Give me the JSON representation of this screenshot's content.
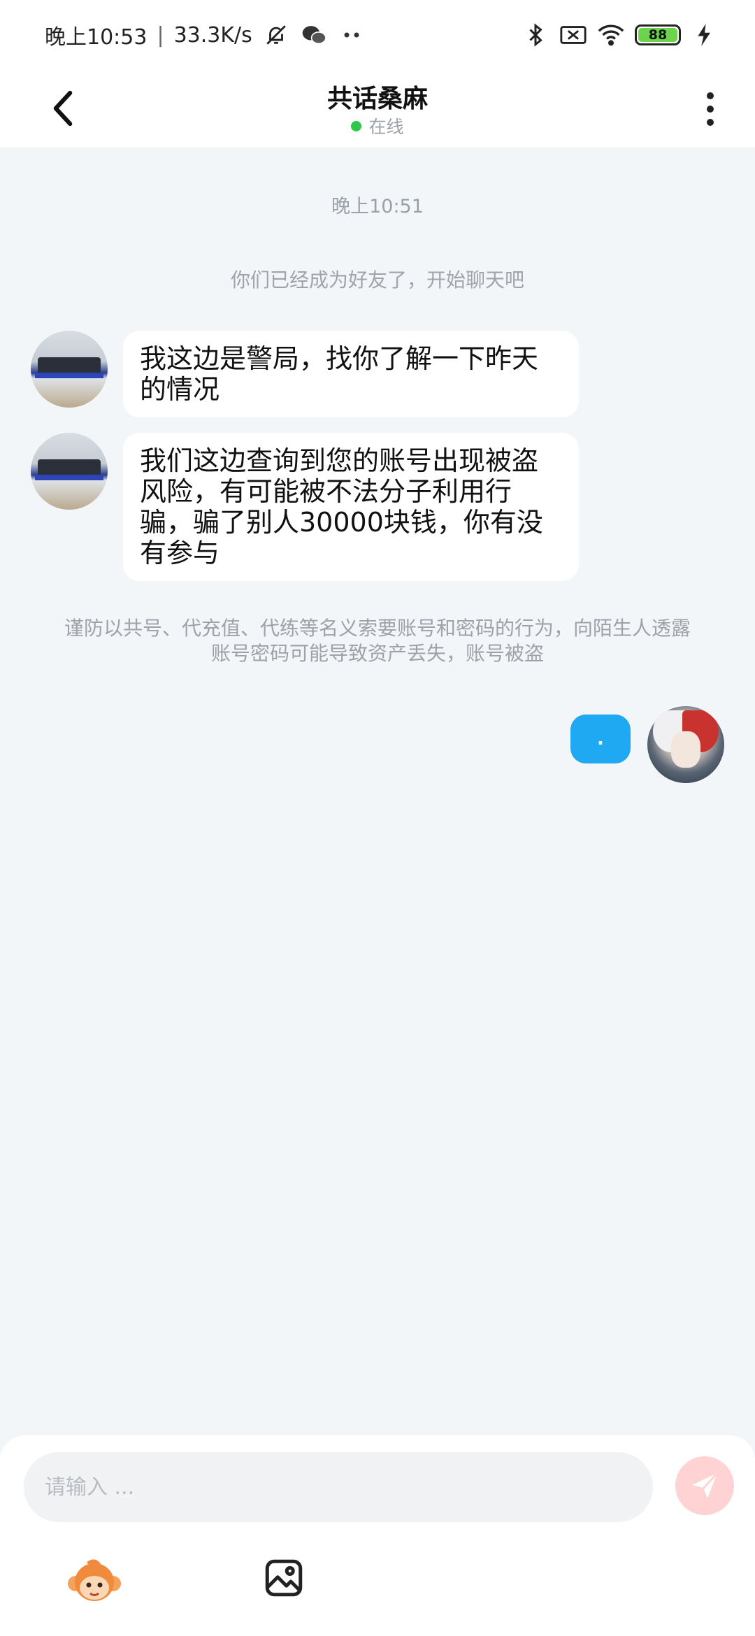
{
  "status_bar": {
    "time": "晚上10:53",
    "net_speed": "33.3K/s",
    "battery": "88",
    "icons": [
      "bell-off-icon",
      "wechat-icon",
      "more-dots-icon",
      "bluetooth-icon",
      "no-sim-icon",
      "wifi-icon",
      "battery-icon",
      "charging-icon"
    ]
  },
  "header": {
    "title": "共话桑麻",
    "status": "在线",
    "status_color": "#2dc84a"
  },
  "chat": {
    "time_label": "晚上10:51",
    "system_message": "你们已经成为好友了，开始聊天吧",
    "messages": [
      {
        "from": "other",
        "text": "我这边是警局，找你了解一下昨天的情况"
      },
      {
        "from": "other",
        "text": "我们这边查询到您的账号出现被盗风险，有可能被不法分子利用行骗，骗了别人30000块钱，你有没有参与"
      }
    ],
    "warning": "谨防以共号、代充值、代练等名义索要账号和密码的行为，向陌生人透露账号密码可能导致资产丢失，账号被盗",
    "outgoing": {
      "text": ".",
      "color": "#1fa9f2"
    }
  },
  "composer": {
    "placeholder": "请输入 ...",
    "send_color": "#ffd3d3"
  }
}
